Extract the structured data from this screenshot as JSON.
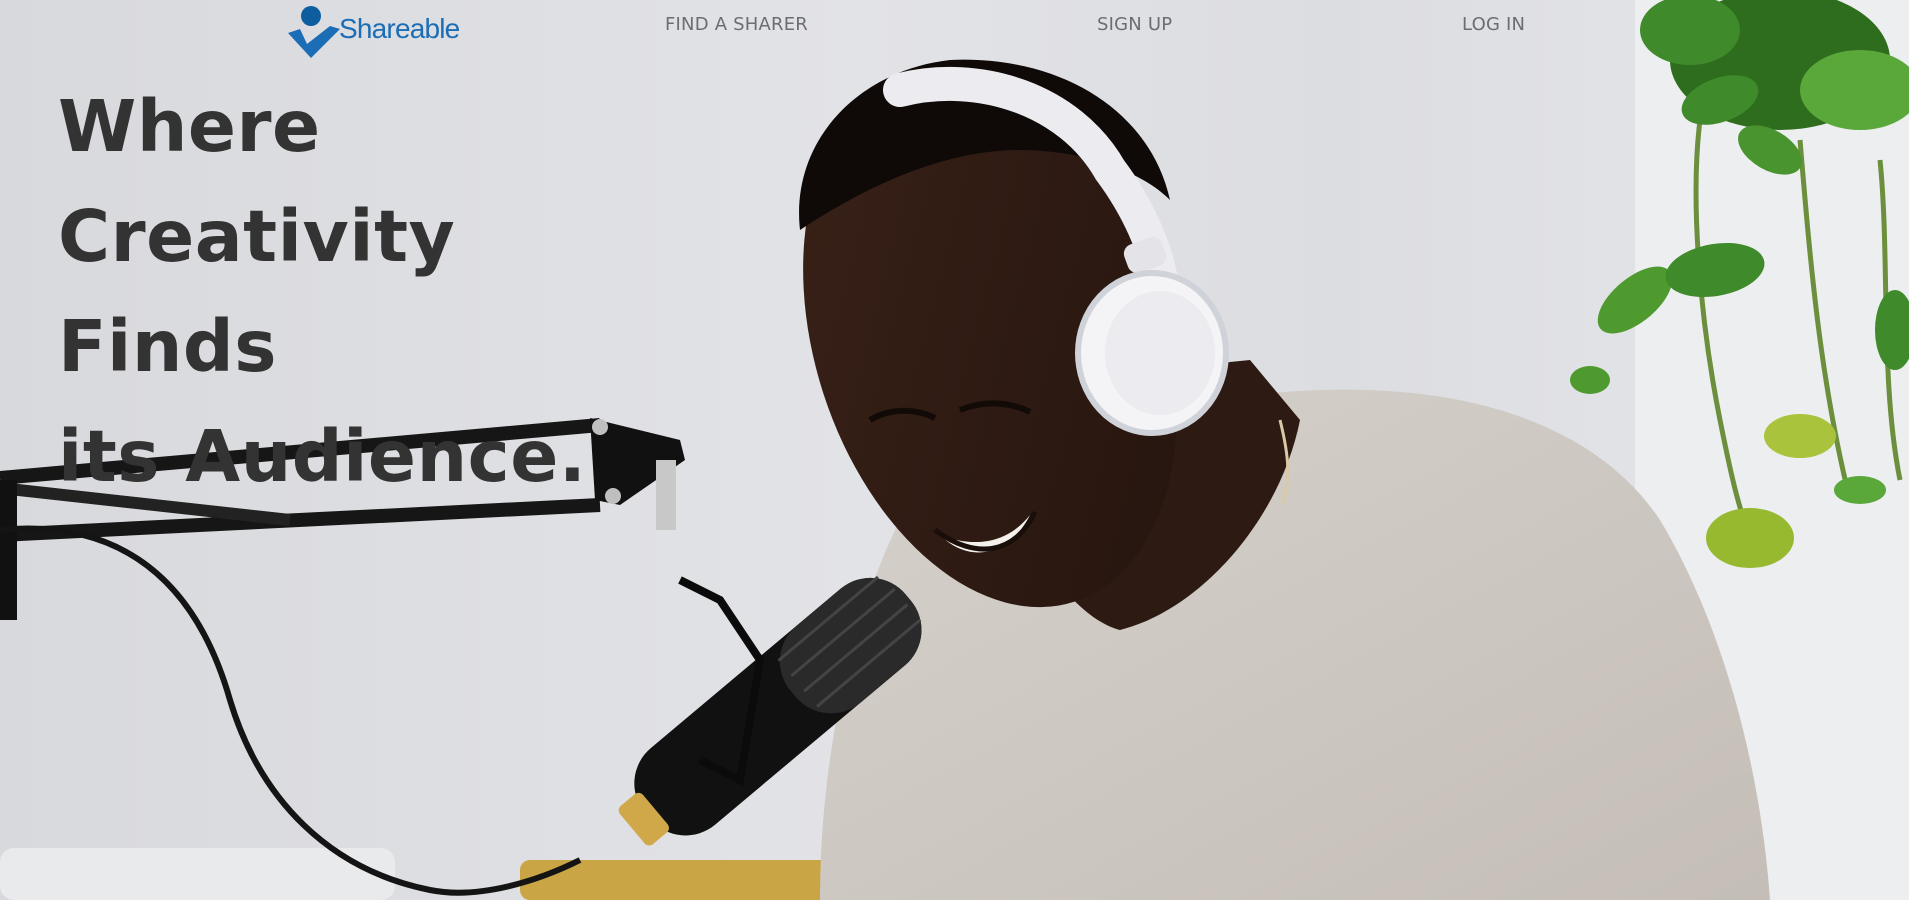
{
  "header": {
    "logo_text": "Shareable",
    "nav": {
      "find_a_sharer": "FIND A SHARER",
      "sign_up": "SIGN UP",
      "log_in": "LOG IN"
    }
  },
  "hero": {
    "headline_lines": [
      "Where",
      "Creativity Finds",
      "its Audience."
    ]
  },
  "colors": {
    "brand": "#1b6db6",
    "brand_dark": "#0e5e9f",
    "nav_text": "#6c6d70",
    "headline": "#333333"
  },
  "icons": {
    "logo": "shareable-person-check-logo"
  }
}
